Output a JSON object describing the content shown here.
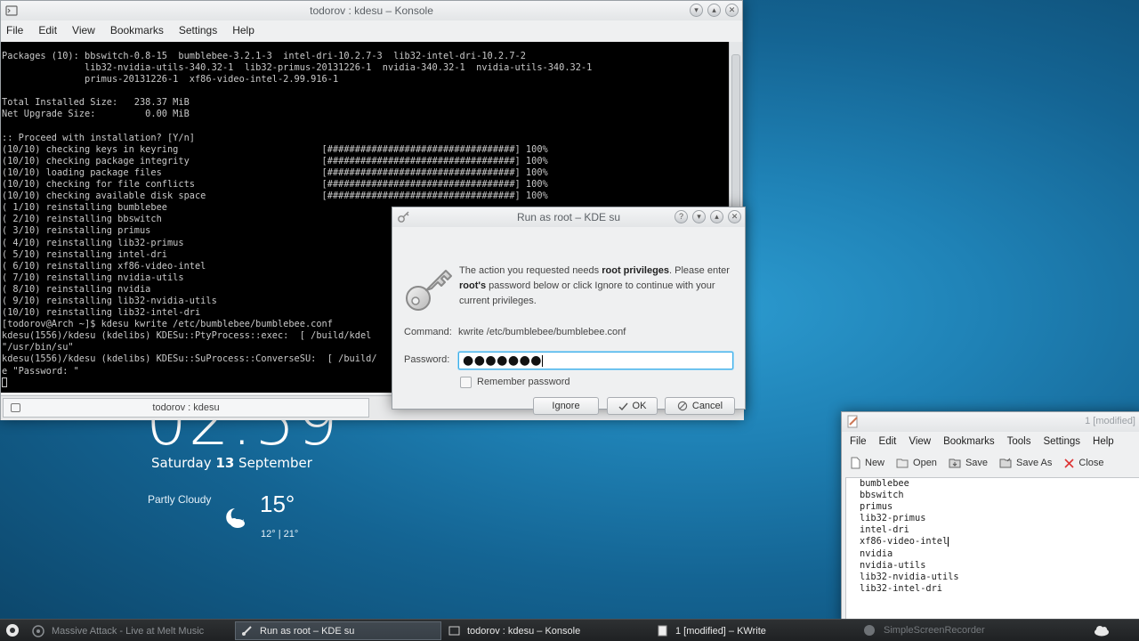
{
  "desktop": {
    "clock_time": "02:59",
    "date_day": "Saturday",
    "date_num": "13",
    "date_month": "September",
    "weather_condition": "Partly Cloudy",
    "weather_temp": "15°",
    "weather_range": "12° | 21°"
  },
  "konsole": {
    "title": "todorov : kdesu – Konsole",
    "menu": [
      "File",
      "Edit",
      "View",
      "Bookmarks",
      "Settings",
      "Help"
    ],
    "tab_label": "todorov : kdesu",
    "lines": [
      "Packages (10): bbswitch-0.8-15  bumblebee-3.2.1-3  intel-dri-10.2.7-3  lib32-intel-dri-10.2.7-2",
      "               lib32-nvidia-utils-340.32-1  lib32-primus-20131226-1  nvidia-340.32-1  nvidia-utils-340.32-1",
      "               primus-20131226-1  xf86-video-intel-2.99.916-1",
      "",
      "Total Installed Size:   238.37 MiB",
      "Net Upgrade Size:         0.00 MiB",
      "",
      ":: Proceed with installation? [Y/n]",
      "(10/10) checking keys in keyring                          [##################################] 100%",
      "(10/10) checking package integrity                        [##################################] 100%",
      "(10/10) loading package files                             [##################################] 100%",
      "(10/10) checking for file conflicts                       [##################################] 100%",
      "(10/10) checking available disk space                     [##################################] 100%",
      "( 1/10) reinstalling bumblebee",
      "( 2/10) reinstalling bbswitch",
      "( 3/10) reinstalling primus",
      "( 4/10) reinstalling lib32-primus",
      "( 5/10) reinstalling intel-dri",
      "( 6/10) reinstalling xf86-video-intel",
      "( 7/10) reinstalling nvidia-utils",
      "( 8/10) reinstalling nvidia",
      "( 9/10) reinstalling lib32-nvidia-utils",
      "(10/10) reinstalling lib32-intel-dri",
      "[todorov@Arch ~]$ kdesu kwrite /etc/bumblebee/bumblebee.conf",
      "kdesu(1556)/kdesu (kdelibs) KDESu::PtyProcess::exec:  [ /build/kdel",
      "\"/usr/bin/su\"",
      "kdesu(1556)/kdesu (kdelibs) KDESu::SuProcess::ConverseSU:  [ /build/",
      "e \"Password: \"",
      ""
    ]
  },
  "dialog": {
    "title": "Run as root – KDE su",
    "msg_1": "The action you requested needs ",
    "msg_bold_1": "root privileges",
    "msg_2": ". Please enter ",
    "msg_bold_2": "root's",
    "msg_3": " password below or click Ignore to continue with your current privileges.",
    "command_label": "Command:",
    "command_value": "kwrite /etc/bumblebee/bumblebee.conf",
    "password_label": "Password:",
    "password_value": "●●●●●●●",
    "remember_label": "Remember password",
    "ignore_label": "Ignore",
    "ok_label": "OK",
    "cancel_label": "Cancel"
  },
  "kwrite": {
    "title": "1 [modified]",
    "menu": [
      "File",
      "Edit",
      "View",
      "Bookmarks",
      "Tools",
      "Settings",
      "Help"
    ],
    "toolbar": {
      "new": "New",
      "open": "Open",
      "save": "Save",
      "save_as": "Save As",
      "close": "Close"
    },
    "lines": [
      "bumblebee",
      "bbswitch",
      "primus",
      "lib32-primus",
      "intel-dri",
      "xf86-video-intel",
      "nvidia",
      "nvidia-utils",
      "lib32-nvidia-utils",
      "lib32-intel-dri"
    ]
  },
  "taskbar": {
    "media": "Massive Attack - Live at Melt Music",
    "tasks": [
      "Run as root – KDE su",
      "todorov : kdesu – Konsole",
      "1 [modified] – KWrite"
    ],
    "tray_text": "SimpleScreenRecorder"
  },
  "colors": {
    "accent": "#3daee9",
    "desktop": "#1f82b6",
    "terminal_bg": "#000000"
  }
}
